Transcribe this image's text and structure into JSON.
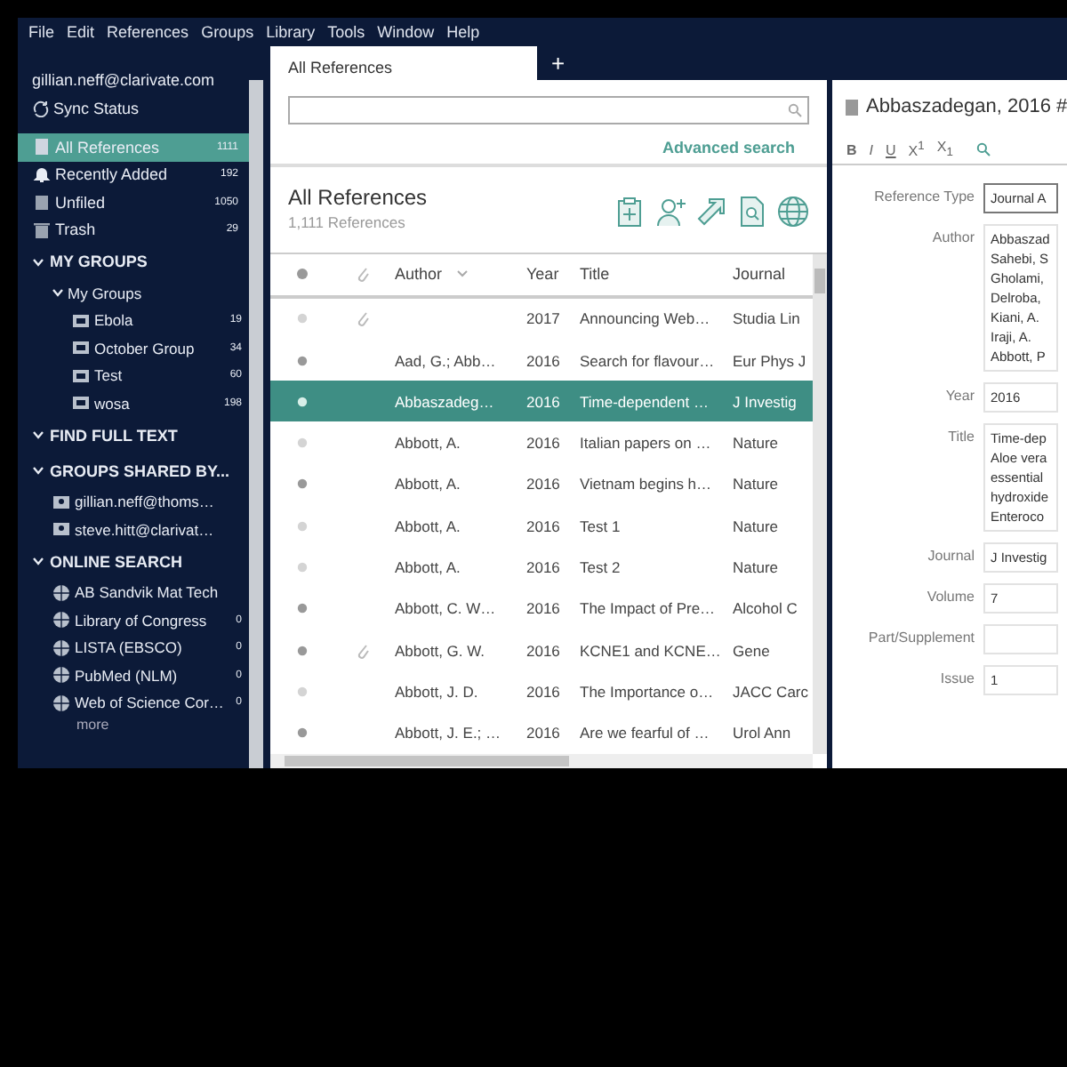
{
  "menu": [
    "File",
    "Edit",
    "References",
    "Groups",
    "Library",
    "Tools",
    "Window",
    "Help"
  ],
  "sidebar": {
    "account": "gillian.neff@clarivate.com",
    "sync_status": "Sync Status",
    "library": [
      {
        "kind": "all",
        "label": "All References",
        "count": "1111",
        "selected": true
      },
      {
        "kind": "recent",
        "label": "Recently Added",
        "count": "192",
        "selected": false
      },
      {
        "kind": "unfiled",
        "label": "Unfiled",
        "count": "1050",
        "selected": false
      },
      {
        "kind": "trash",
        "label": "Trash",
        "count": "29",
        "selected": false
      }
    ],
    "sections": [
      {
        "heading": "MY GROUPS",
        "expanded": true,
        "children": [
          {
            "kind": "set",
            "label": "My Groups",
            "expanded": true,
            "children": [
              {
                "kind": "group",
                "label": "Ebola",
                "count": "19"
              },
              {
                "kind": "group",
                "label": "October Group",
                "count": "34"
              },
              {
                "kind": "group",
                "label": "Test",
                "count": "60"
              },
              {
                "kind": "group",
                "label": "wosa",
                "count": "198"
              }
            ]
          }
        ]
      },
      {
        "heading": "FIND FULL TEXT",
        "expanded": true
      },
      {
        "heading": "GROUPS SHARED BY...",
        "expanded": true,
        "children": [
          {
            "kind": "shared",
            "label": "gillian.neff@thoms…"
          },
          {
            "kind": "shared",
            "label": "steve.hitt@clarivat…"
          }
        ]
      },
      {
        "heading": "ONLINE SEARCH",
        "expanded": true,
        "children": [
          {
            "kind": "online",
            "label": "AB Sandvik Mat Tech"
          },
          {
            "kind": "online",
            "label": "Library of Congress",
            "count": "0"
          },
          {
            "kind": "online",
            "label": "LISTA (EBSCO)",
            "count": "0"
          },
          {
            "kind": "online",
            "label": "PubMed (NLM)",
            "count": "0"
          },
          {
            "kind": "online",
            "label": "Web of Science Cor…",
            "count": "0"
          }
        ]
      }
    ],
    "more": "more"
  },
  "tabs": [
    {
      "label": "All References",
      "selected": true
    }
  ],
  "new_tab": "+",
  "search": {
    "advanced": "Advanced search"
  },
  "list": {
    "title": "All References",
    "count": "1,111 References",
    "columns": [
      "Author",
      "Year",
      "Title",
      "Journal"
    ],
    "rows": [
      {
        "read": true,
        "attachment": true,
        "year": "2017",
        "title": "Announcing Web…",
        "journal": "Studia Lin",
        "selected": false
      },
      {
        "read": false,
        "attachment": false,
        "author": "Aad, G.; Abb…",
        "year": "2016",
        "title": "Search for flavour…",
        "journal": "Eur Phys J",
        "selected": false
      },
      {
        "read": false,
        "attachment": false,
        "author": "Abbaszadeg…",
        "year": "2016",
        "title": "Time-dependent …",
        "journal": "J Investig",
        "selected": true
      },
      {
        "read": true,
        "attachment": false,
        "author": "Abbott, A.",
        "year": "2016",
        "title": "Italian papers on …",
        "journal": "Nature",
        "selected": false
      },
      {
        "read": false,
        "attachment": false,
        "author": "Abbott, A.",
        "year": "2016",
        "title": "Vietnam begins h…",
        "journal": "Nature",
        "selected": false
      },
      {
        "read": true,
        "attachment": false,
        "author": "Abbott, A.",
        "year": "2016",
        "title": "Test 1",
        "journal": "Nature",
        "selected": false
      },
      {
        "read": true,
        "attachment": false,
        "author": "Abbott, A.",
        "year": "2016",
        "title": "Test 2",
        "journal": "Nature",
        "selected": false
      },
      {
        "read": false,
        "attachment": false,
        "author": "Abbott, C. W…",
        "year": "2016",
        "title": "The Impact of Pre…",
        "journal": "Alcohol C",
        "selected": false
      },
      {
        "read": false,
        "attachment": true,
        "author": "Abbott, G. W.",
        "year": "2016",
        "title": "KCNE1 and KCNE…",
        "journal": "Gene",
        "selected": false
      },
      {
        "read": true,
        "attachment": false,
        "author": "Abbott, J. D.",
        "year": "2016",
        "title": "The Importance o…",
        "journal": "JACC Carc",
        "selected": false
      },
      {
        "read": false,
        "attachment": false,
        "author": "Abbott, J. E.; …",
        "year": "2016",
        "title": "Are we fearful of …",
        "journal": "Urol Ann",
        "selected": false
      }
    ]
  },
  "detail": {
    "title": "Abbaszadegan, 2016 #",
    "format": [
      "B",
      "I",
      "U",
      "X$^{1}$",
      "X$_{1}$"
    ],
    "fields": [
      {
        "label": "Reference Type",
        "lines": [
          "Journal A"
        ],
        "focused": true
      },
      {
        "label": "Author",
        "lines": [
          "Abbaszad",
          "Sahebi, S",
          "Gholami,",
          "Delroba,",
          "Kiani, A.",
          "Iraji, A.",
          "Abbott, P"
        ],
        "focused": false
      },
      {
        "label": "Year",
        "lines": [
          "2016"
        ],
        "focused": false
      },
      {
        "label": "Title",
        "lines": [
          "Time-dep",
          "Aloe vera",
          "essential",
          "hydroxide",
          "Enteroco"
        ],
        "focused": false
      },
      {
        "label": "Journal",
        "lines": [
          "J Investig"
        ],
        "focused": false
      },
      {
        "label": "Volume",
        "lines": [
          "7"
        ],
        "focused": false
      },
      {
        "label": "Part/Supplement",
        "focused": false
      },
      {
        "label": "Issue",
        "lines": [
          "1"
        ],
        "focused": false
      }
    ]
  }
}
